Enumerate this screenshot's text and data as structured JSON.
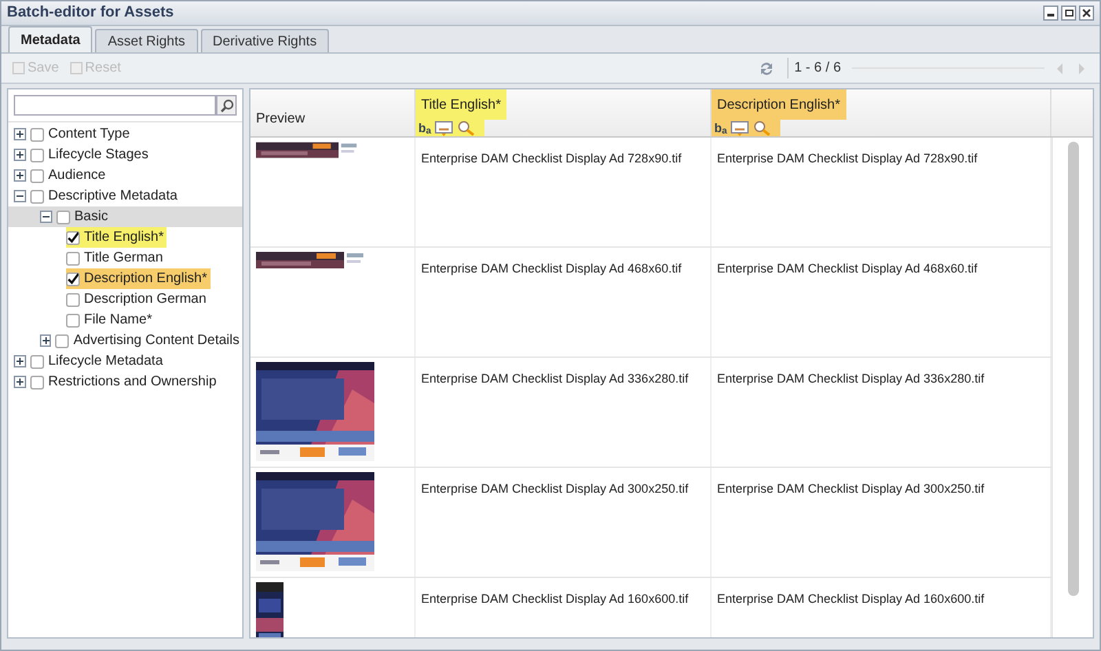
{
  "window": {
    "title": "Batch-editor for Assets"
  },
  "tabs": [
    {
      "label": "Metadata",
      "selected": true
    },
    {
      "label": "Asset Rights",
      "selected": false
    },
    {
      "label": "Derivative Rights",
      "selected": false
    }
  ],
  "toolbar": {
    "buttons": [
      {
        "label": "Save",
        "disabled": true
      },
      {
        "label": "Reset",
        "disabled": true
      }
    ],
    "paging": "1 - 6 / 6"
  },
  "tree": {
    "items": [
      {
        "label": "Content Type",
        "expanded": false,
        "checked": false,
        "selected": false
      },
      {
        "label": "Lifecycle Stages",
        "expanded": false,
        "checked": false,
        "selected": false
      },
      {
        "label": "Audience",
        "expanded": false,
        "checked": false,
        "selected": false
      },
      {
        "label": "Descriptive Metadata",
        "expanded": true,
        "checked": false,
        "selected": false,
        "children": [
          {
            "label": "Basic",
            "expanded": true,
            "checked": false,
            "selected": true,
            "children": [
              {
                "label": "Title English*",
                "checked": true,
                "selected": false,
                "color": "#f7f06a"
              },
              {
                "label": "Title German",
                "checked": false,
                "selected": false
              },
              {
                "label": "Description English*",
                "checked": true,
                "selected": false,
                "color": "#f7cd6c"
              },
              {
                "label": "Description German",
                "checked": false,
                "selected": false
              },
              {
                "label": "File Name*",
                "checked": false,
                "selected": false
              }
            ]
          },
          {
            "label": "Advertising Content Details",
            "expanded": false,
            "checked": false,
            "selected": false
          }
        ]
      },
      {
        "label": "Lifecycle Metadata",
        "expanded": false,
        "checked": false,
        "selected": false
      },
      {
        "label": "Restrictions and Ownership",
        "expanded": false,
        "checked": false,
        "selected": false
      }
    ]
  },
  "grid": {
    "columns": [
      {
        "label": "Preview"
      },
      {
        "label": "Title English*",
        "color": "#f7f06a",
        "case_icon": "b$_{a}$"
      },
      {
        "label": "Description English*",
        "color": "#f7cd6c",
        "case_icon": "b$_{a}$"
      }
    ],
    "rows": [
      {
        "title": "Enterprise DAM Checklist Display Ad 728x90.tif",
        "description": "Enterprise DAM Checklist Display Ad 728x90.tif"
      },
      {
        "title": "Enterprise DAM Checklist Display Ad 468x60.tif",
        "description": "Enterprise DAM Checklist Display Ad 468x60.tif"
      },
      {
        "title": "Enterprise DAM Checklist Display Ad 336x280.tif",
        "description": "Enterprise DAM Checklist Display Ad 336x280.tif"
      },
      {
        "title": "Enterprise DAM Checklist Display Ad 300x250.tif",
        "description": "Enterprise DAM Checklist Display Ad 300x250.tif"
      },
      {
        "title": "Enterprise DAM Checklist Display Ad 160x600.tif",
        "description": "Enterprise DAM Checklist Display Ad 160x600.tif"
      }
    ]
  }
}
